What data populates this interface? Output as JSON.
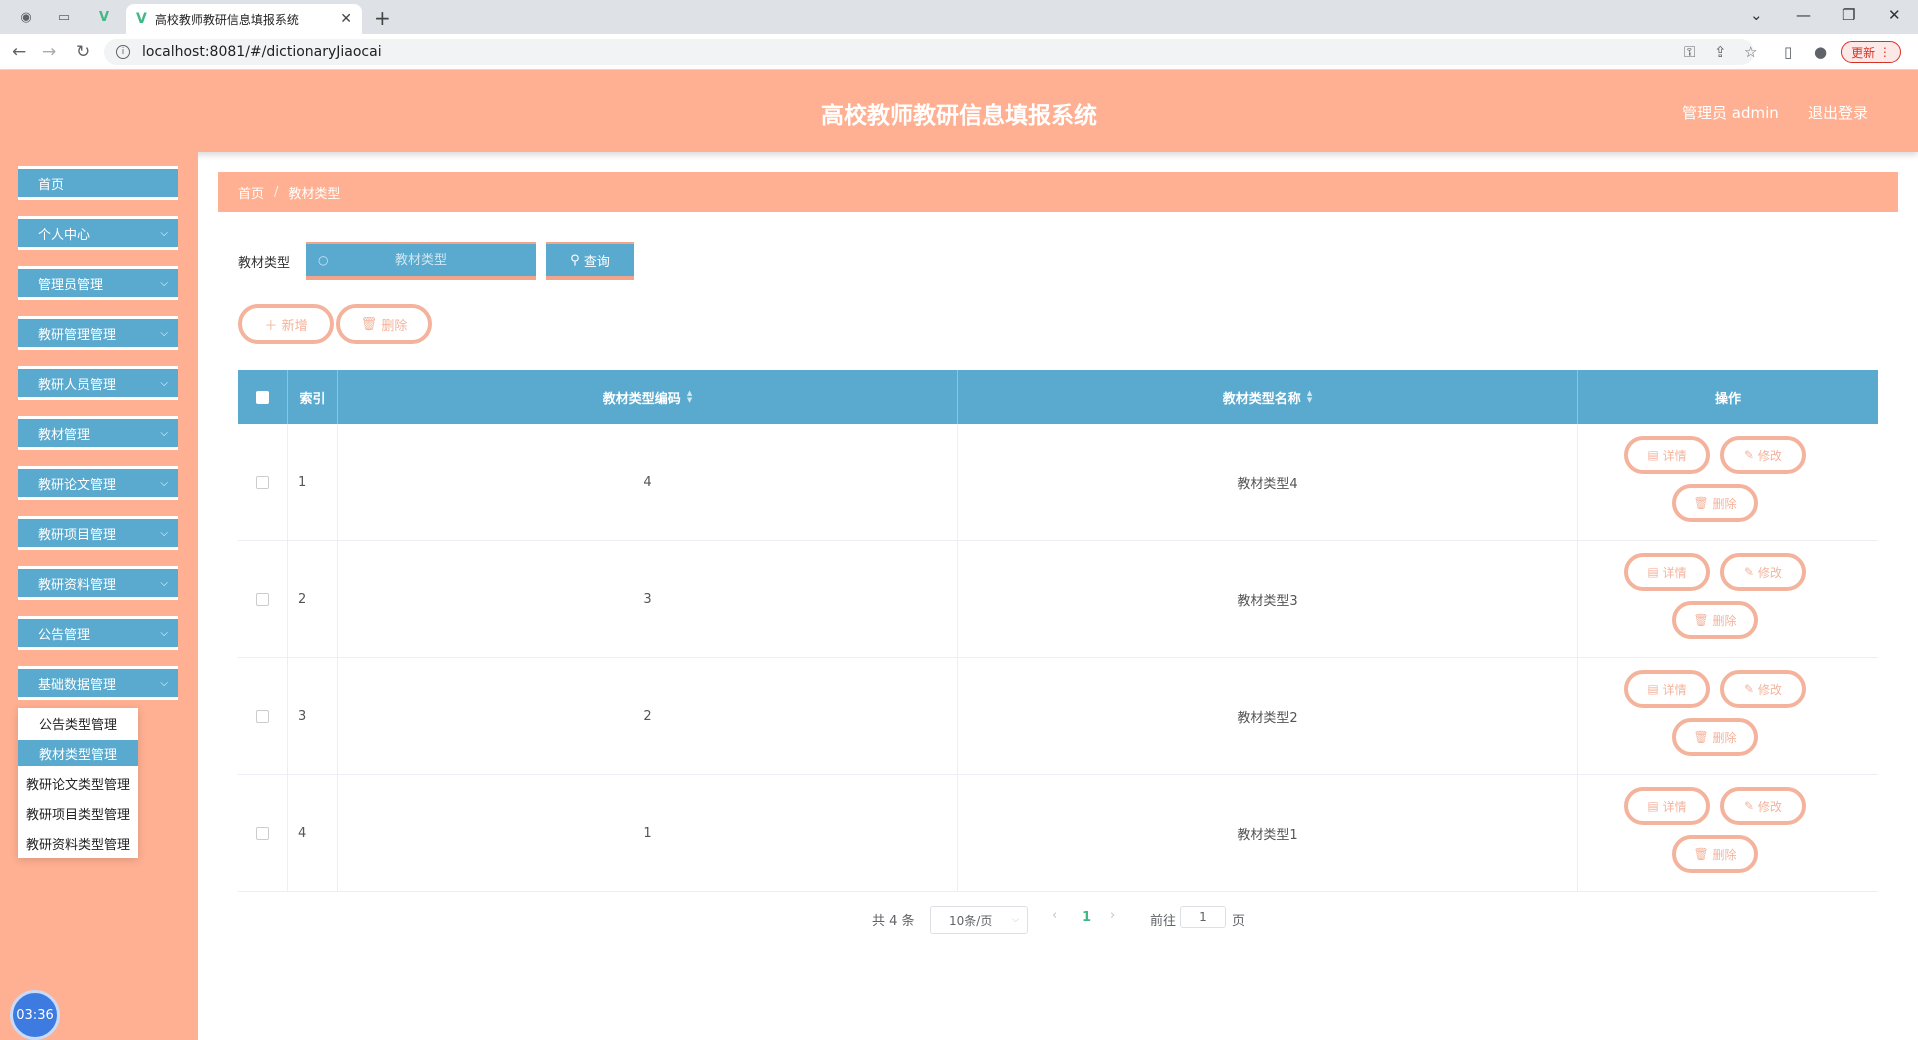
{
  "browser": {
    "tab_title": "高校教师教研信息填报系统",
    "url": "localhost:8081/#/dictionaryJiaocai",
    "update_label": "更新"
  },
  "header": {
    "title": "高校教师教研信息填报系统",
    "user": "管理员 admin",
    "logout": "退出登录"
  },
  "sidebar": {
    "items": [
      {
        "label": "首页"
      },
      {
        "label": "个人中心"
      },
      {
        "label": "管理员管理"
      },
      {
        "label": "教研管理管理"
      },
      {
        "label": "教研人员管理"
      },
      {
        "label": "教材管理"
      },
      {
        "label": "教研论文管理"
      },
      {
        "label": "教研项目管理"
      },
      {
        "label": "教研资料管理"
      },
      {
        "label": "公告管理"
      },
      {
        "label": "基础数据管理"
      }
    ],
    "submenu": [
      {
        "label": "公告类型管理"
      },
      {
        "label": "教材类型管理"
      },
      {
        "label": "教研论文类型管理"
      },
      {
        "label": "教研项目类型管理"
      },
      {
        "label": "教研资料类型管理"
      }
    ],
    "clock": "03:36"
  },
  "breadcrumb": {
    "home": "首页",
    "current": "教材类型"
  },
  "search": {
    "label": "教材类型",
    "placeholder": "教材类型",
    "button": "查询"
  },
  "actions": {
    "add": "新增",
    "delete": "删除"
  },
  "table": {
    "headers": {
      "index": "索引",
      "code": "教材类型编码",
      "name": "教材类型名称",
      "ops": "操作"
    },
    "rows": [
      {
        "index": "1",
        "code": "4",
        "name": "教材类型4"
      },
      {
        "index": "2",
        "code": "3",
        "name": "教材类型3"
      },
      {
        "index": "3",
        "code": "2",
        "name": "教材类型2"
      },
      {
        "index": "4",
        "code": "1",
        "name": "教材类型1"
      }
    ],
    "row_actions": {
      "detail": "详情",
      "edit": "修改",
      "delete": "删除"
    }
  },
  "pagination": {
    "total": "共 4 条",
    "page_size": "10条/页",
    "current_page": "1",
    "goto_prefix": "前往",
    "goto_value": "1",
    "goto_suffix": "页"
  }
}
